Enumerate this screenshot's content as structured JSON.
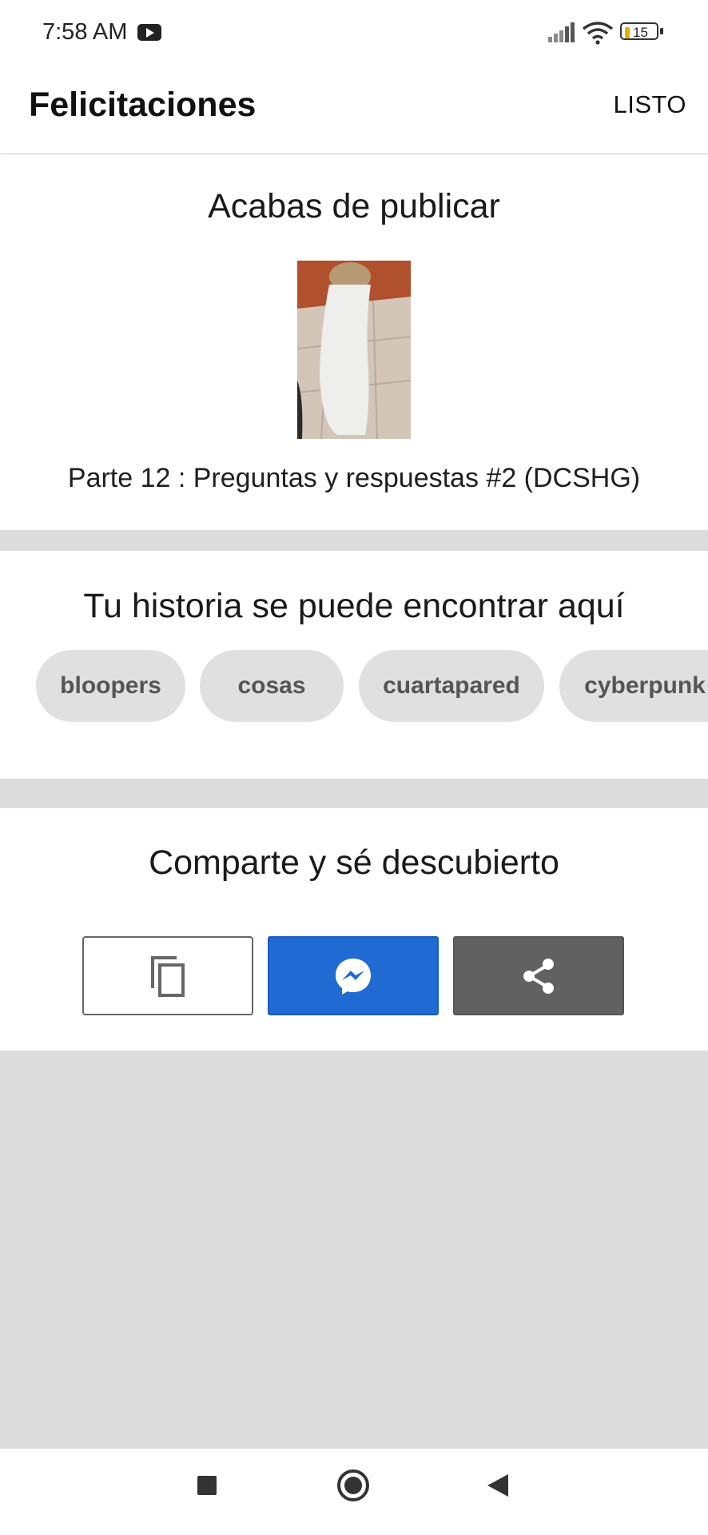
{
  "status_bar": {
    "time": "7:58 AM",
    "battery": "15",
    "icons": [
      "youtube-icon",
      "signal-icon",
      "wifi-icon",
      "battery-icon"
    ]
  },
  "app_bar": {
    "title": "Felicitaciones",
    "done_label": "LISTO"
  },
  "published": {
    "heading": "Acabas de publicar",
    "story_title": "Parte 12 : Preguntas y respuestas #2 (DCSHG)"
  },
  "tags": {
    "heading": "Tu historia se puede encontrar aquí",
    "items": [
      "bloopers",
      "cosas",
      "cuartapared",
      "cyberpunk"
    ]
  },
  "share": {
    "heading": "Comparte y sé descubierto",
    "buttons": [
      "copy-link-icon",
      "messenger-icon",
      "share-icon"
    ]
  },
  "colors": {
    "messenger_blue": "#1f6ad3",
    "share_gray": "#616161",
    "tag_bg": "#e0e0e0",
    "page_bg": "#dcdcdc"
  },
  "nav_bar": {
    "icons": [
      "recents-square-icon",
      "home-circle-icon",
      "back-triangle-icon"
    ]
  }
}
